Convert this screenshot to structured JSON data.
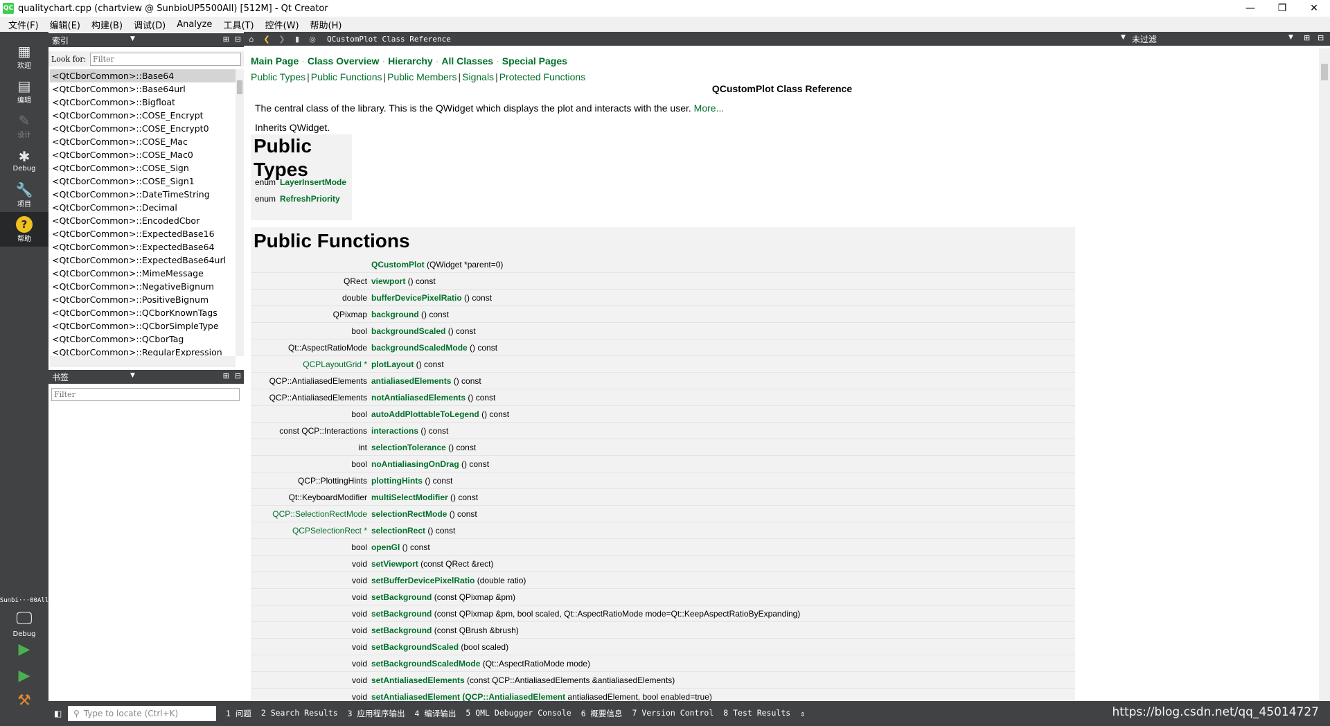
{
  "window": {
    "title": "qualitychart.cpp (chartview @ SunbioUP5500All) [512M] - Qt Creator",
    "logo": "QC"
  },
  "menus": [
    "文件(F)",
    "编辑(E)",
    "构建(B)",
    "调试(D)",
    "Analyze",
    "工具(T)",
    "控件(W)",
    "帮助(H)"
  ],
  "modes": [
    {
      "label": "欢迎",
      "icon": "grid-icon"
    },
    {
      "label": "编辑",
      "icon": "document-icon"
    },
    {
      "label": "设计",
      "icon": "pencil-icon"
    },
    {
      "label": "Debug",
      "icon": "bug-icon"
    },
    {
      "label": "项目",
      "icon": "wrench-icon"
    },
    {
      "label": "帮助",
      "icon": "help-icon"
    }
  ],
  "kit": {
    "name": "Sunbi···00All",
    "mode": "Debug"
  },
  "index_panel": {
    "title": "索引",
    "look_for": "Look for:",
    "filter_placeholder": "Filter",
    "items": [
      "<QtCborCommon>::Base64",
      "<QtCborCommon>::Base64url",
      "<QtCborCommon>::Bigfloat",
      "<QtCborCommon>::COSE_Encrypt",
      "<QtCborCommon>::COSE_Encrypt0",
      "<QtCborCommon>::COSE_Mac",
      "<QtCborCommon>::COSE_Mac0",
      "<QtCborCommon>::COSE_Sign",
      "<QtCborCommon>::COSE_Sign1",
      "<QtCborCommon>::DateTimeString",
      "<QtCborCommon>::Decimal",
      "<QtCborCommon>::EncodedCbor",
      "<QtCborCommon>::ExpectedBase16",
      "<QtCborCommon>::ExpectedBase64",
      "<QtCborCommon>::ExpectedBase64url",
      "<QtCborCommon>::MimeMessage",
      "<QtCborCommon>::NegativeBignum",
      "<QtCborCommon>::PositiveBignum",
      "<QtCborCommon>::QCborKnownTags",
      "<QtCborCommon>::QCborSimpleType",
      "<QtCborCommon>::QCborTag",
      "<QtCborCommon>::RegularExpression"
    ]
  },
  "bookmark_panel": {
    "title": "书签",
    "filter_placeholder": "Filter"
  },
  "doc_toolbar": {
    "title": "QCustomPlot Class Reference",
    "filter_combo": "未过滤"
  },
  "doc": {
    "nav": [
      "Main Page",
      "Class Overview",
      "Hierarchy",
      "All Classes",
      "Special Pages"
    ],
    "nav_sep": "·",
    "sub": [
      "Public Types",
      "Public Functions",
      "Public Members",
      "Signals",
      "Protected Functions"
    ],
    "sub_sep": "|",
    "title": "QCustomPlot Class Reference",
    "intro": "The central class of the library. This is the QWidget which displays the plot and interacts with the user.",
    "more": "More...",
    "inherits": "Inherits QWidget.",
    "public_types_heading": "Public Types",
    "public_types": [
      {
        "kw": "enum",
        "name": "LayerInsertMode"
      },
      {
        "kw": "enum",
        "name": "RefreshPriority"
      }
    ],
    "public_functions_heading": "Public Functions",
    "functions": [
      {
        "ret": "",
        "name": "QCustomPlot",
        "args": " (QWidget *parent=0)",
        "ret_link": false
      },
      {
        "ret": "QRect",
        "name": "viewport",
        "args": " () const",
        "ret_link": false
      },
      {
        "ret": "double",
        "name": "bufferDevicePixelRatio",
        "args": " () const",
        "ret_link": false
      },
      {
        "ret": "QPixmap",
        "name": "background",
        "args": " () const",
        "ret_link": false
      },
      {
        "ret": "bool",
        "name": "backgroundScaled",
        "args": " () const",
        "ret_link": false
      },
      {
        "ret": "Qt::AspectRatioMode",
        "name": "backgroundScaledMode",
        "args": " () const",
        "ret_link": false
      },
      {
        "ret": "QCPLayoutGrid *",
        "name": "plotLayout",
        "args": " () const",
        "ret_link": true
      },
      {
        "ret": "QCP::AntialiasedElements",
        "name": "antialiasedElements",
        "args": " () const",
        "ret_link": false
      },
      {
        "ret": "QCP::AntialiasedElements",
        "name": "notAntialiasedElements",
        "args": " () const",
        "ret_link": false
      },
      {
        "ret": "bool",
        "name": "autoAddPlottableToLegend",
        "args": " () const",
        "ret_link": false
      },
      {
        "ret": "const QCP::Interactions",
        "name": "interactions",
        "args": " () const",
        "ret_link": false
      },
      {
        "ret": "int",
        "name": "selectionTolerance",
        "args": " () const",
        "ret_link": false
      },
      {
        "ret": "bool",
        "name": "noAntialiasingOnDrag",
        "args": " () const",
        "ret_link": false
      },
      {
        "ret": "QCP::PlottingHints",
        "name": "plottingHints",
        "args": " () const",
        "ret_link": false
      },
      {
        "ret": "Qt::KeyboardModifier",
        "name": "multiSelectModifier",
        "args": " () const",
        "ret_link": false
      },
      {
        "ret": "QCP::SelectionRectMode",
        "name": "selectionRectMode",
        "args": " () const",
        "ret_link": true
      },
      {
        "ret": "QCPSelectionRect *",
        "name": "selectionRect",
        "args": " () const",
        "ret_link": true
      },
      {
        "ret": "bool",
        "name": "openGl",
        "args": " () const",
        "ret_link": false
      },
      {
        "ret": "void",
        "name": "setViewport",
        "args": " (const QRect &rect)",
        "ret_link": false
      },
      {
        "ret": "void",
        "name": "setBufferDevicePixelRatio",
        "args": " (double ratio)",
        "ret_link": false
      },
      {
        "ret": "void",
        "name": "setBackground",
        "args": " (const QPixmap &pm)",
        "ret_link": false
      },
      {
        "ret": "void",
        "name": "setBackground",
        "args": " (const QPixmap &pm, bool scaled, Qt::AspectRatioMode mode=Qt::KeepAspectRatioByExpanding)",
        "ret_link": false
      },
      {
        "ret": "void",
        "name": "setBackground",
        "args": " (const QBrush &brush)",
        "ret_link": false
      },
      {
        "ret": "void",
        "name": "setBackgroundScaled",
        "args": " (bool scaled)",
        "ret_link": false
      },
      {
        "ret": "void",
        "name": "setBackgroundScaledMode",
        "args": " (Qt::AspectRatioMode mode)",
        "ret_link": false
      },
      {
        "ret": "void",
        "name": "setAntialiasedElements",
        "args": " (const QCP::AntialiasedElements &antialiasedElements)",
        "ret_link": false
      },
      {
        "ret": "void",
        "name": "setAntialiasedElement",
        "args": " antialiasedElement, bool enabled=true)",
        "ret_link": false,
        "extra": " (QCP::AntialiasedElement"
      }
    ]
  },
  "statusbar": {
    "locate_placeholder": "Type to locate (Ctrl+K)",
    "tabs": [
      "1 问题",
      "2 Search Results",
      "3 应用程序输出",
      "4 编译输出",
      "5 QML Debugger Console",
      "6 概要信息",
      "7 Version Control",
      "8 Test Results"
    ],
    "watermark": "https://blog.csdn.net/qq_45014727"
  },
  "colors": {
    "link": "#00702a",
    "sidebar": "#404244",
    "active_mode": "#262829"
  }
}
